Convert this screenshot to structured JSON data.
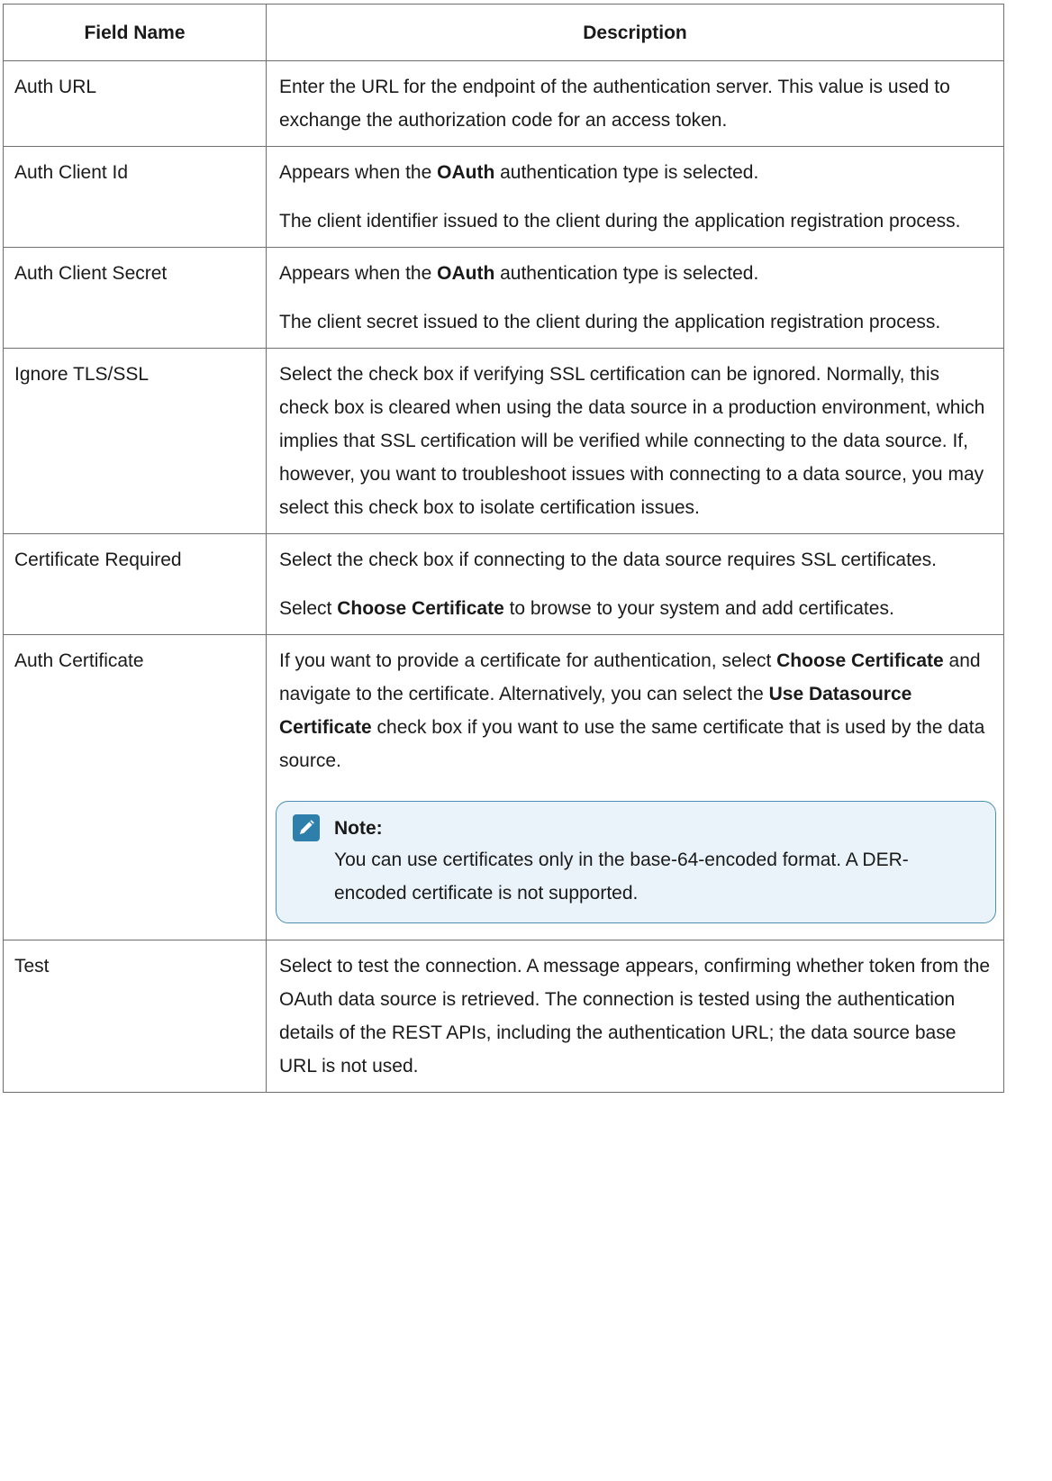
{
  "table": {
    "headers": [
      "Field Name",
      "Description"
    ],
    "rows": [
      {
        "name": "Auth URL",
        "paragraphs": [
          [
            "Enter the URL for the endpoint of the authentication server. This value is used to exchange the authorization code for an access token."
          ]
        ]
      },
      {
        "name": "Auth Client Id",
        "paragraphs": [
          [
            "Appears when the ",
            "OAuth",
            " authentication type is selected."
          ],
          [
            "The client identifier issued to the client during the application registration process."
          ]
        ]
      },
      {
        "name": "Auth Client Secret",
        "paragraphs": [
          [
            "Appears when the ",
            "OAuth",
            " authentication type is selected."
          ],
          [
            "The client secret issued to the client during the application registration process."
          ]
        ]
      },
      {
        "name": "Ignore TLS/SSL",
        "paragraphs": [
          [
            "Select the check box if verifying SSL certification can be ignored. Normally, this check box is cleared when using the data source in a production environment, which implies that SSL certification will be verified while connecting to the data source. If, however, you want to troubleshoot issues with connecting to a data source, you may select this check box to isolate certification issues."
          ]
        ]
      },
      {
        "name": "Certificate Required",
        "paragraphs": [
          [
            "Select the check box if connecting to the data source requires SSL certificates."
          ],
          [
            "Select ",
            "Choose Certificate",
            " to browse to your system and add certificates."
          ]
        ]
      },
      {
        "name": "Auth Certificate",
        "paragraphs": [
          [
            "If you want to provide a certificate for authentication, select ",
            "Choose Certificate",
            " and navigate to the certificate. Alternatively, you can select the ",
            "Use Datasource Certificate",
            " check box if you want to use the same certificate that is used by the data source."
          ]
        ],
        "note": {
          "title": "Note:",
          "text": "You can use certificates only in the base-64-encoded format. A DER-encoded certificate is not supported.",
          "icon": "pencil-note-icon"
        }
      },
      {
        "name": "Test",
        "paragraphs": [
          [
            "Select to test the connection. A message appears, confirming whether token from the OAuth data source is retrieved. The connection is tested using the authentication details of the REST APIs, including the authentication URL; the data source base URL is not used."
          ]
        ]
      }
    ]
  },
  "colors": {
    "border": "#6f6f6f",
    "note_border": "#4c8fb3",
    "note_bg": "#e9f3f9",
    "note_icon": "#2f7fad"
  }
}
